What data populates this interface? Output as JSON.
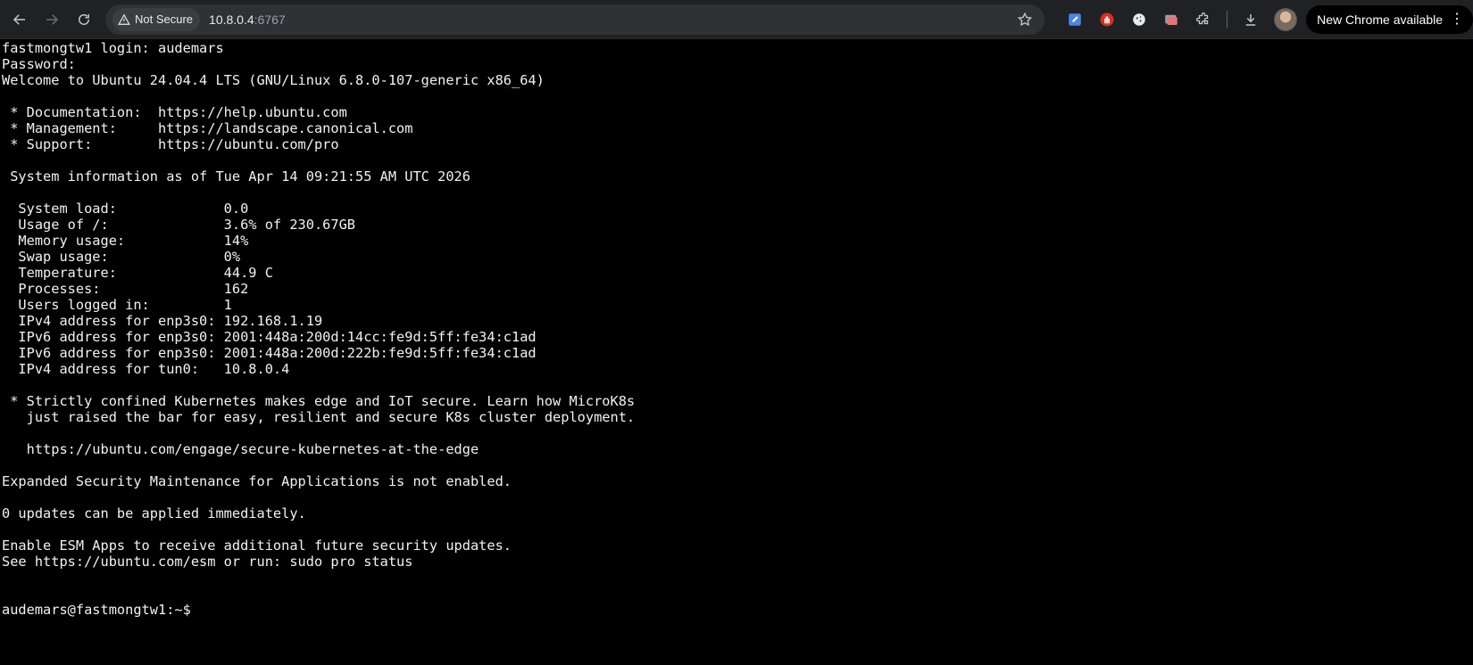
{
  "browser": {
    "security_label": "Not Secure",
    "url_host": "10.8.0.4",
    "url_port": ":6767",
    "update_button_label": "New Chrome available",
    "update_button_menu": "⋮"
  },
  "terminal": {
    "lines": [
      "fastmongtw1 login: audemars",
      "Password:",
      "Welcome to Ubuntu 24.04.4 LTS (GNU/Linux 6.8.0-107-generic x86_64)",
      "",
      " * Documentation:  https://help.ubuntu.com",
      " * Management:     https://landscape.canonical.com",
      " * Support:        https://ubuntu.com/pro",
      "",
      " System information as of Tue Apr 14 09:21:55 AM UTC 2026",
      "",
      "  System load:             0.0",
      "  Usage of /:              3.6% of 230.67GB",
      "  Memory usage:            14%",
      "  Swap usage:              0%",
      "  Temperature:             44.9 C",
      "  Processes:               162",
      "  Users logged in:         1",
      "  IPv4 address for enp3s0: 192.168.1.19",
      "  IPv6 address for enp3s0: 2001:448a:200d:14cc:fe9d:5ff:fe34:c1ad",
      "  IPv6 address for enp3s0: 2001:448a:200d:222b:fe9d:5ff:fe34:c1ad",
      "  IPv4 address for tun0:   10.8.0.4",
      "",
      " * Strictly confined Kubernetes makes edge and IoT secure. Learn how MicroK8s",
      "   just raised the bar for easy, resilient and secure K8s cluster deployment.",
      "",
      "   https://ubuntu.com/engage/secure-kubernetes-at-the-edge",
      "",
      "Expanded Security Maintenance for Applications is not enabled.",
      "",
      "0 updates can be applied immediately.",
      "",
      "Enable ESM Apps to receive additional future security updates.",
      "See https://ubuntu.com/esm or run: sudo pro status",
      "",
      "",
      "audemars@fastmongtw1:~$"
    ]
  },
  "icons": {
    "back": "back-arrow-icon",
    "forward": "forward-arrow-icon",
    "reload": "reload-icon",
    "warning": "warning-triangle-icon",
    "bookmark": "star-icon",
    "download": "download-icon",
    "extensions": "puzzle-icon"
  },
  "colors": {
    "terminal_bg": "#000000",
    "terminal_fg": "#f2f2f2",
    "toolbar_bg": "#202124",
    "omnibox_bg": "#303134"
  }
}
